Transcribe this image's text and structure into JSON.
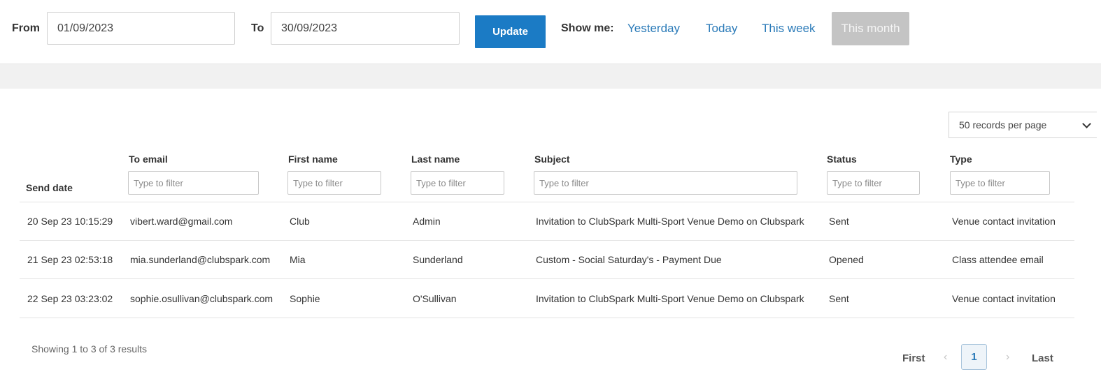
{
  "filter_bar": {
    "from_label": "From",
    "from_value": "01/09/2023",
    "to_label": "To",
    "to_value": "30/09/2023",
    "update_label": "Update",
    "show_me_label": "Show me:",
    "quick_links": [
      "Yesterday",
      "Today",
      "This week"
    ],
    "active_quick_link": "This month"
  },
  "records_per_page": "50 records per page",
  "table": {
    "columns": {
      "send_date": "Send date",
      "to_email": "To email",
      "first_name": "First name",
      "last_name": "Last name",
      "subject": "Subject",
      "status": "Status",
      "type": "Type"
    },
    "filter_placeholder": "Type to filter",
    "rows": [
      [
        "20 Sep 23 10:15:29",
        "vibert.ward@gmail.com",
        "Club",
        "Admin",
        "Invitation to ClubSpark Multi-Sport Venue Demo on Clubspark",
        "Sent",
        "Venue contact invitation"
      ],
      [
        "21 Sep 23 02:53:18",
        "mia.sunderland@clubspark.com",
        "Mia",
        "Sunderland",
        "Custom - Social Saturday's - Payment Due",
        "Opened",
        "Class attendee email"
      ],
      [
        "22 Sep 23 03:23:02",
        "sophie.osullivan@clubspark.com",
        "Sophie",
        "O'Sullivan",
        "Invitation to ClubSpark Multi-Sport Venue Demo on Clubspark",
        "Sent",
        "Venue contact invitation"
      ]
    ]
  },
  "footer": {
    "showing": "Showing 1 to 3 of 3 results",
    "first": "First",
    "prev_icon": "‹",
    "current_page": "1",
    "next_icon": "›",
    "last": "Last"
  },
  "colors": {
    "accent": "#1b7bc5",
    "link": "#2a7ab8",
    "active_tab": "#c4c4c4"
  }
}
